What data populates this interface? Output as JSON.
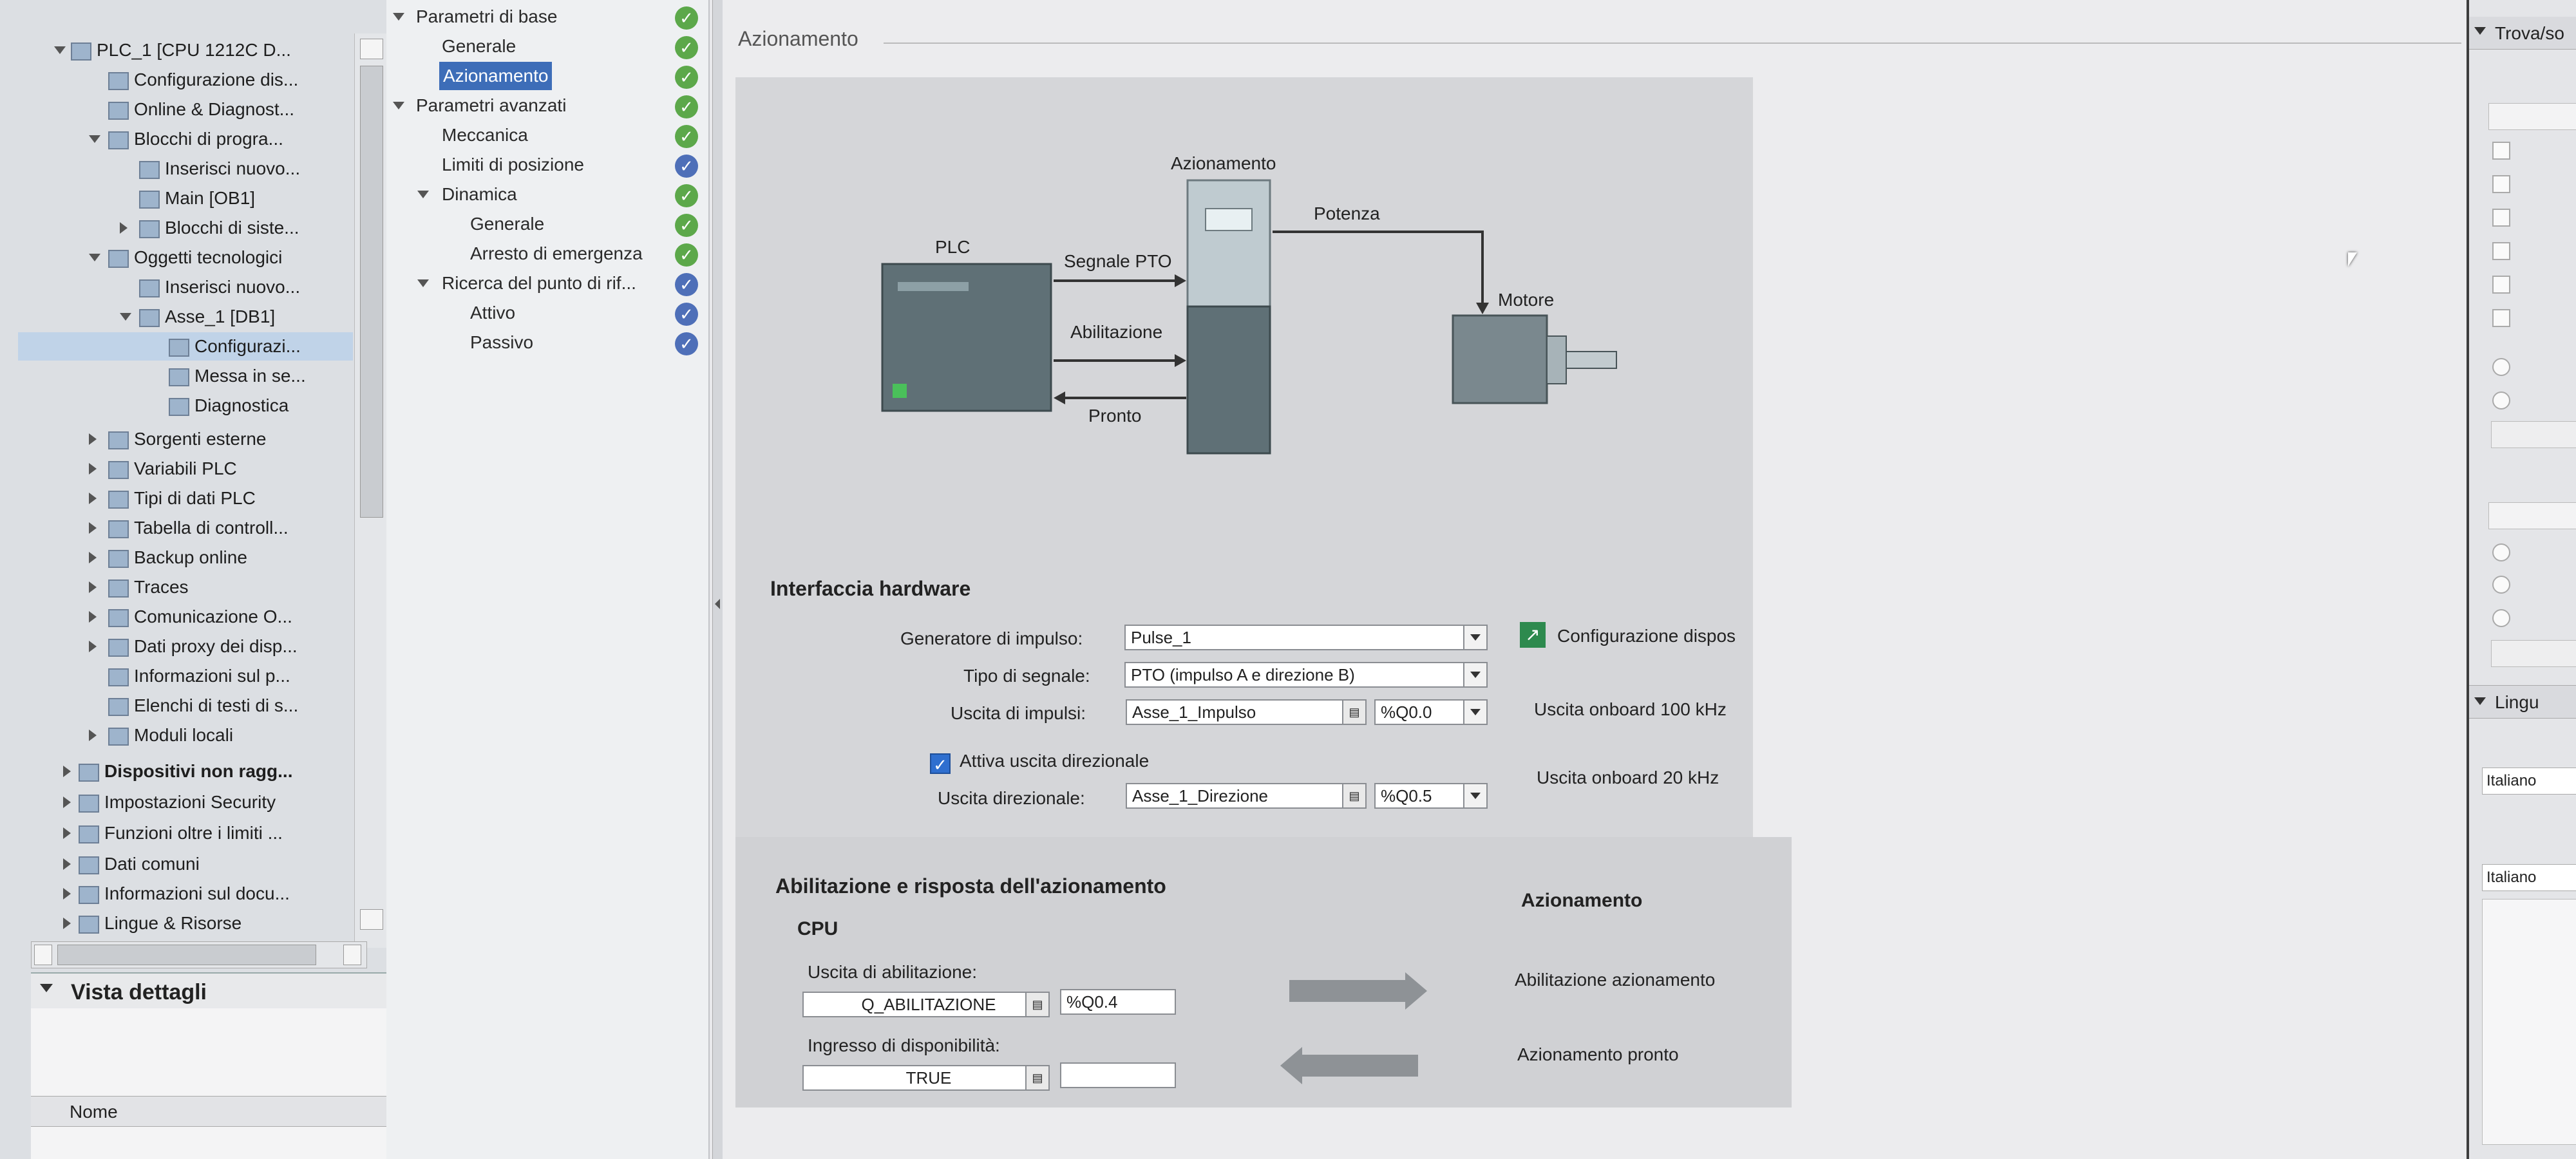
{
  "tree": {
    "items": [
      {
        "label": "PLC_1 [CPU 1212C D..."
      },
      {
        "label": "Configurazione dis..."
      },
      {
        "label": "Online & Diagnost..."
      },
      {
        "label": "Blocchi di progra..."
      },
      {
        "label": "Inserisci nuovo..."
      },
      {
        "label": "Main [OB1]"
      },
      {
        "label": "Blocchi di siste..."
      },
      {
        "label": "Oggetti tecnologici"
      },
      {
        "label": "Inserisci nuovo..."
      },
      {
        "label": "Asse_1 [DB1]"
      },
      {
        "label": "Configurazi..."
      },
      {
        "label": "Messa in se..."
      },
      {
        "label": "Diagnostica"
      },
      {
        "label": "Sorgenti esterne"
      },
      {
        "label": "Variabili PLC"
      },
      {
        "label": "Tipi di dati PLC"
      },
      {
        "label": "Tabella di controll..."
      },
      {
        "label": "Backup online"
      },
      {
        "label": "Traces"
      },
      {
        "label": "Comunicazione O..."
      },
      {
        "label": "Dati proxy dei disp..."
      },
      {
        "label": "Informazioni sul p..."
      },
      {
        "label": "Elenchi di testi di s..."
      },
      {
        "label": "Moduli locali"
      },
      {
        "label": "Dispositivi non ragg..."
      },
      {
        "label": "Impostazioni Security"
      },
      {
        "label": "Funzioni oltre i limiti ..."
      },
      {
        "label": "Dati comuni"
      },
      {
        "label": "Informazioni sul docu..."
      },
      {
        "label": "Lingue & Risorse"
      }
    ],
    "details_title": "Vista dettagli",
    "details_column": "Nome"
  },
  "nav": {
    "items": [
      {
        "label": "Parametri di base"
      },
      {
        "label": "Generale"
      },
      {
        "label": "Azionamento"
      },
      {
        "label": "Parametri avanzati"
      },
      {
        "label": "Meccanica"
      },
      {
        "label": "Limiti di posizione"
      },
      {
        "label": "Dinamica"
      },
      {
        "label": "Generale"
      },
      {
        "label": "Arresto di emergenza"
      },
      {
        "label": "Ricerca del punto di rif..."
      },
      {
        "label": "Attivo"
      },
      {
        "label": "Passivo"
      }
    ]
  },
  "main": {
    "title": "Azionamento",
    "diagram": {
      "plc": "PLC",
      "drive": "Azionamento",
      "motor": "Motore",
      "power": "Potenza",
      "pto_signal": "Segnale PTO",
      "enable": "Abilitazione",
      "ready": "Pronto"
    },
    "hw": {
      "title": "Interfaccia hardware",
      "pulse_gen_label": "Generatore di impulso:",
      "pulse_gen_value": "Pulse_1",
      "device_config": "Configurazione dispos",
      "signal_type_label": "Tipo di segnale:",
      "signal_type_value": "PTO (impulso A e direzione B)",
      "pulse_out_label": "Uscita di impulsi:",
      "pulse_out_tag": "Asse_1_Impulso",
      "pulse_out_addr": "%Q0.0",
      "pulse_out_info": "Uscita onboard 100 kHz",
      "dir_enable_label": "Attiva uscita direzionale",
      "dir_out_label": "Uscita direzionale:",
      "dir_out_tag": "Asse_1_Direzione",
      "dir_out_addr": "%Q0.5",
      "dir_out_info": "Uscita onboard 20 kHz"
    },
    "enable": {
      "title": "Abilitazione e risposta dell'azionamento",
      "cpu": "CPU",
      "drive": "Azionamento",
      "enable_out_label": "Uscita di abilitazione:",
      "enable_out_tag": "Q_ABILITAZIONE",
      "enable_out_addr": "%Q0.4",
      "enable_drive_label": "Abilitazione azionamento",
      "ready_in_label": "Ingresso di disponibilità:",
      "ready_in_tag": "TRUE",
      "ready_in_addr": "",
      "drive_ready_label": "Azionamento pronto"
    }
  },
  "right": {
    "tab": "Trova/so",
    "lang_header": "Lingu",
    "lang_value_1": "Italiano",
    "lang_value_2": "Italiano"
  }
}
